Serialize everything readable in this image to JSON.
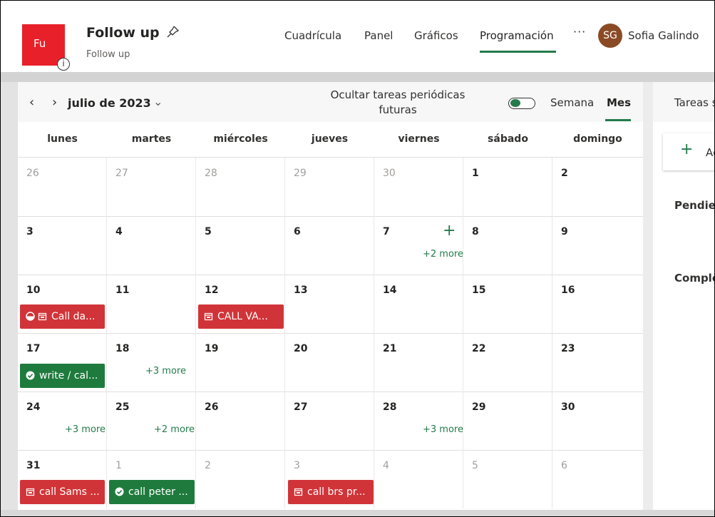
{
  "app": {
    "logo_text": "Fu",
    "title": "Follow up",
    "subtitle": "Follow up"
  },
  "nav": {
    "tabs": [
      "Cuadrícula",
      "Panel",
      "Gráficos",
      "Programación"
    ],
    "active_tab": "Programación",
    "more": "···"
  },
  "user": {
    "initials": "SG",
    "name": "Sofia Galindo"
  },
  "calendar": {
    "month_label": "julio de 2023",
    "hide_recurring_label": "Ocultar tareas periódicas futuras",
    "hide_recurring_on": true,
    "view_week": "Semana",
    "view_month": "Mes",
    "active_view": "Mes",
    "weekdays": [
      "lunes",
      "martes",
      "miércoles",
      "jueves",
      "viernes",
      "sábado",
      "domingo"
    ],
    "weeks": [
      [
        "26",
        "27",
        "28",
        "29",
        "30",
        "1",
        "2"
      ],
      [
        "3",
        "4",
        "5",
        "6",
        "7",
        "8",
        "9"
      ],
      [
        "10",
        "11",
        "12",
        "13",
        "14",
        "15",
        "16"
      ],
      [
        "17",
        "18",
        "19",
        "20",
        "21",
        "22",
        "23"
      ],
      [
        "24",
        "25",
        "26",
        "27",
        "28",
        "29",
        "30"
      ],
      [
        "31",
        "1",
        "2",
        "3",
        "4",
        "5",
        "6"
      ]
    ],
    "more_labels": {
      "w1_fri": "+2 more",
      "w3_tue": "+3 more",
      "w4_mon": "+3 more",
      "w4_tue": "+2 more",
      "w4_fri": "+3 more"
    },
    "events": {
      "call_da": "Call da...",
      "call_va": "CALL VA...",
      "write_cal": "write / cal...",
      "call_sams": "call Sams ...",
      "call_peter": "call peter ...",
      "call_brs": "call brs pr..."
    }
  },
  "right_panel": {
    "title": "Tareas s",
    "add_label": "Ag",
    "pending": "Pendien",
    "completed": "Comple"
  },
  "colors": {
    "brand_red": "#e8202a",
    "accent_green": "#237b4b",
    "event_red": "#d13438",
    "event_green": "#1e7b3d"
  }
}
